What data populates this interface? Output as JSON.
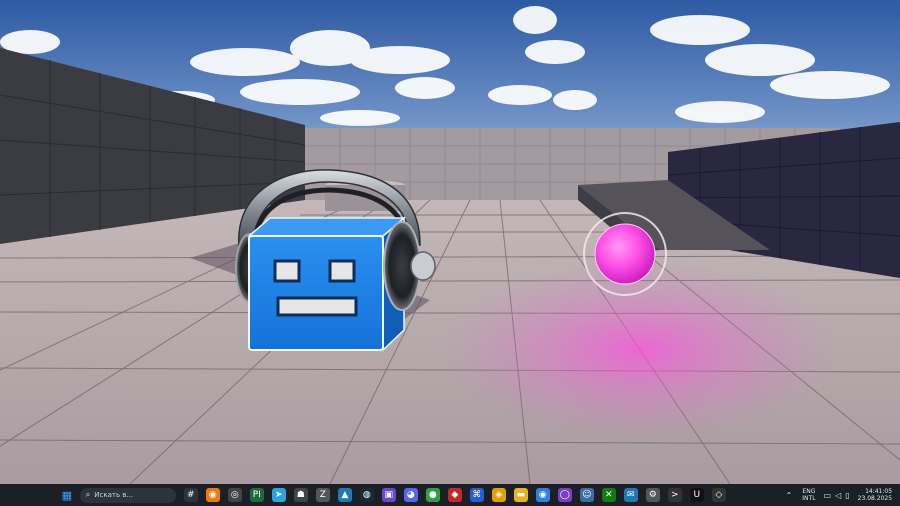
{
  "scene": {
    "description_colors": {
      "sky_top": "#2d5aa3",
      "sky_bottom": "#a8bfd9",
      "wall": "#3a3b40",
      "floor": "#b6a9ad",
      "cube": "#1e82e8",
      "orb": "#ff56e8"
    }
  },
  "taskbar": {
    "search_placeholder": "Искать в...",
    "tray_lang_top": "ENG",
    "tray_lang_bottom": "INTL",
    "clock_time": "14:41:05",
    "clock_date": "23.08.2025",
    "apps": [
      {
        "name": "windows-start-icon",
        "glyph": "▦",
        "color": "#3aa0ff"
      },
      {
        "name": "hashtag-app-icon",
        "glyph": "#",
        "color": "#2e323a"
      },
      {
        "name": "blender-icon",
        "glyph": "◉",
        "color": "#e87d0d"
      },
      {
        "name": "eye-app-icon",
        "glyph": "◎",
        "color": "#444"
      },
      {
        "name": "pycharm-icon",
        "glyph": "PI",
        "color": "#1f6b3a"
      },
      {
        "name": "telegram-icon",
        "glyph": "➤",
        "color": "#2aa3e0"
      },
      {
        "name": "game-app-icon",
        "glyph": "☗",
        "color": "#444"
      },
      {
        "name": "zbrush-icon",
        "glyph": "Z",
        "color": "#555"
      },
      {
        "name": "image-editor-icon",
        "glyph": "▲",
        "color": "#1f7ab3"
      },
      {
        "name": "steam-icon",
        "glyph": "◍",
        "color": "#1b2838"
      },
      {
        "name": "photo-app-icon",
        "glyph": "▣",
        "color": "#6b48c8"
      },
      {
        "name": "discord-icon",
        "glyph": "◕",
        "color": "#5865f2"
      },
      {
        "name": "chat-app-icon",
        "glyph": "●",
        "color": "#2f9e44"
      },
      {
        "name": "red-app-icon",
        "glyph": "◆",
        "color": "#c62828"
      },
      {
        "name": "code-app-icon",
        "glyph": "⌘",
        "color": "#2a5bd7"
      },
      {
        "name": "shield-app-icon",
        "glyph": "◈",
        "color": "#e0a100"
      },
      {
        "name": "folder-icon",
        "glyph": "▬",
        "color": "#e6b422"
      },
      {
        "name": "chrome-icon",
        "glyph": "◉",
        "color": "#2f7fe0"
      },
      {
        "name": "github-icon",
        "glyph": "◯",
        "color": "#7a3fc6"
      },
      {
        "name": "user-app-icon",
        "glyph": "☺",
        "color": "#3a6ea5"
      },
      {
        "name": "xbox-icon",
        "glyph": "✕",
        "color": "#107c10"
      },
      {
        "name": "mail-icon",
        "glyph": "✉",
        "color": "#1f7ab3"
      },
      {
        "name": "settings-app-icon",
        "glyph": "⚙",
        "color": "#555"
      },
      {
        "name": "terminal-icon",
        "glyph": ">",
        "color": "#333"
      },
      {
        "name": "unreal-icon",
        "glyph": "U",
        "color": "#111"
      },
      {
        "name": "unity-icon",
        "glyph": "◇",
        "color": "#333"
      }
    ]
  }
}
